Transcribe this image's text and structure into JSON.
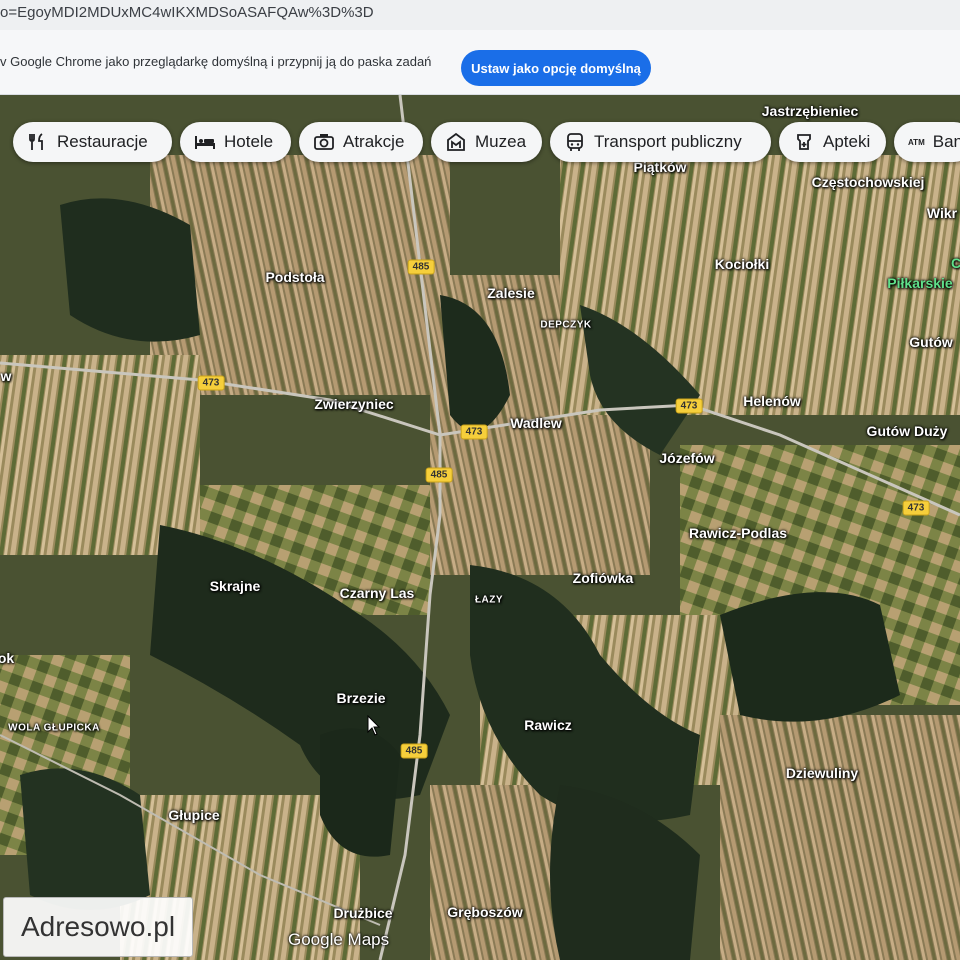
{
  "browser": {
    "url_fragment": "o=EgoyMDI2MDUxMC4wIKXMDSoASAFQAw%3D%3D",
    "infobar_text": "v Google Chrome jako przeglądarkę domyślną i przypnij ją do paska zadań",
    "infobar_button": "Ustaw jako opcję domyślną",
    "accent": "#1a6ee8"
  },
  "chips": [
    {
      "label": "Restauracje",
      "icon": "fork-knife-icon"
    },
    {
      "label": "Hotele",
      "icon": "bed-icon"
    },
    {
      "label": "Atrakcje",
      "icon": "camera-icon"
    },
    {
      "label": "Muzea",
      "icon": "museum-icon"
    },
    {
      "label": "Transport publiczny",
      "icon": "bus-icon"
    },
    {
      "label": "Apteki",
      "icon": "pharmacy-icon"
    },
    {
      "label": "Ban",
      "icon": "atm-icon"
    }
  ],
  "places": {
    "jastrzebieniec": "Jastrzębieniec",
    "piatkow": "Piątków",
    "czestochowskiej": "Częstochowskiej",
    "wikr": "Wikr",
    "podstola": "Podstoła",
    "zalesie": "Zalesie",
    "depczyk": "DEPCZYK",
    "kociolki": "Kociołki",
    "pilkarskie": "Piłkarskie",
    "c": "C",
    "gutow": "Gutów",
    "w": "w",
    "zwierzyniec": "Zwierzyniec",
    "wadlew": "Wadlew",
    "helenow": "Helenów",
    "gutow_duzy": "Gutów Duży",
    "jozefow": "Józefów",
    "rawicz_podlas": "Rawicz-Podlas",
    "skrajne": "Skrajne",
    "czarny_las": "Czarny Las",
    "lazy": "ŁAZY",
    "zofiowka": "Zofiówka",
    "ok": "ok",
    "brzezie": "Brzezie",
    "wola_glupicka": "WOLA GŁUPICKA",
    "rawicz": "Rawicz",
    "dziewuliny": "Dziewuliny",
    "glupice": "Głupice",
    "druzbice": "Drużbice",
    "greboszow": "Gręboszów"
  },
  "roads": {
    "r485": "485",
    "r473": "473"
  },
  "map_logo": "Google Maps",
  "watermark": "Adresowo.pl",
  "colors": {
    "road_shield": "#f6cf3b",
    "poi_label": "#5fe08a"
  }
}
